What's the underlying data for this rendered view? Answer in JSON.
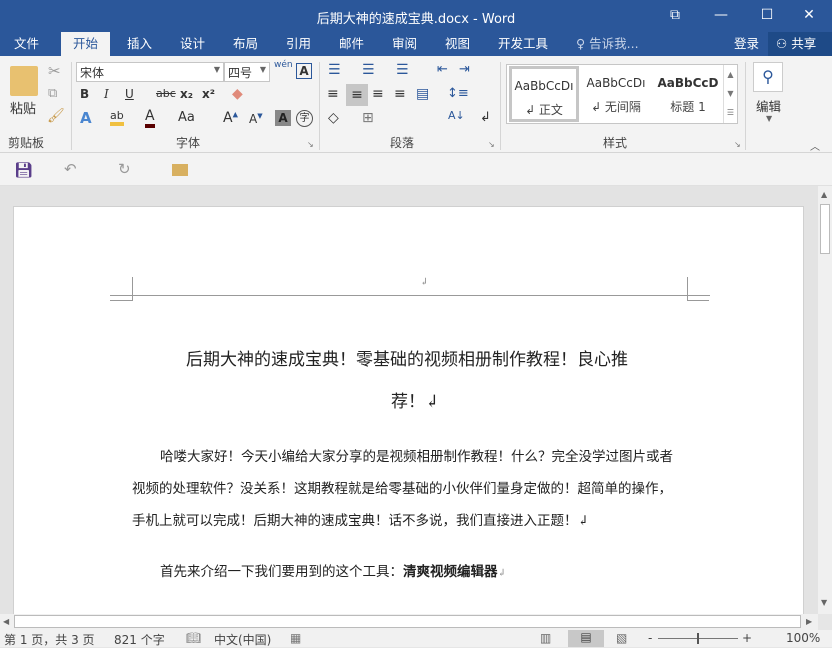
{
  "window": {
    "title": "后期大神的速成宝典.docx - Word",
    "restore_icon": "⧉",
    "minimize": "—",
    "maximize": "☐",
    "close": "✕"
  },
  "tabs": [
    "文件",
    "开始",
    "插入",
    "设计",
    "布局",
    "引用",
    "邮件",
    "审阅",
    "视图",
    "开发工具"
  ],
  "tell_me": "告诉我...",
  "login": "登录",
  "share": "共享",
  "ribbon": {
    "clipboard": {
      "paste": "粘贴",
      "label": "剪贴板"
    },
    "font": {
      "name": "宋体",
      "size": "四号",
      "label": "字体",
      "bold": "B",
      "italic": "I",
      "underline": "U",
      "strike": "abc",
      "sub": "x₂",
      "sup": "x²",
      "case": "Aa",
      "wen": "wén"
    },
    "paragraph": {
      "label": "段落"
    },
    "styles": {
      "label": "样式",
      "items": [
        {
          "preview": "AaBbCcDı",
          "name": "↲ 正文"
        },
        {
          "preview": "AaBbCcDı",
          "name": "↲ 无间隔"
        },
        {
          "preview": "AaBbCcD",
          "name": "标题 1"
        }
      ]
    },
    "editing": {
      "label": "编辑"
    }
  },
  "document": {
    "title_line1": "后期大神的速成宝典！零基础的视频相册制作教程！良心推",
    "title_line2": "荐！↲",
    "para1": [
      "哈喽大家好！今天小编给大家分享的是视频相册制作教程！什么？完全没学过图片或者",
      "视频的处理软件？没关系！这期教程就是给零基础的小伙伴们量身定做的！超简单的操作，",
      "手机上就可以完成！后期大神的速成宝典！话不多说，我们直接进入正题！↲"
    ],
    "para2_prefix": "首先来介绍一下我们要用到的这个工具：",
    "para2_bold": "清爽视频编辑器",
    "para2_mark": "↲",
    "header_mark": "↲"
  },
  "status": {
    "page": "第 1 页，共 3 页",
    "words": "821 个字",
    "lang": "中文(中国)",
    "zoom": "100%",
    "zoom_minus": "-",
    "zoom_plus": "+"
  }
}
